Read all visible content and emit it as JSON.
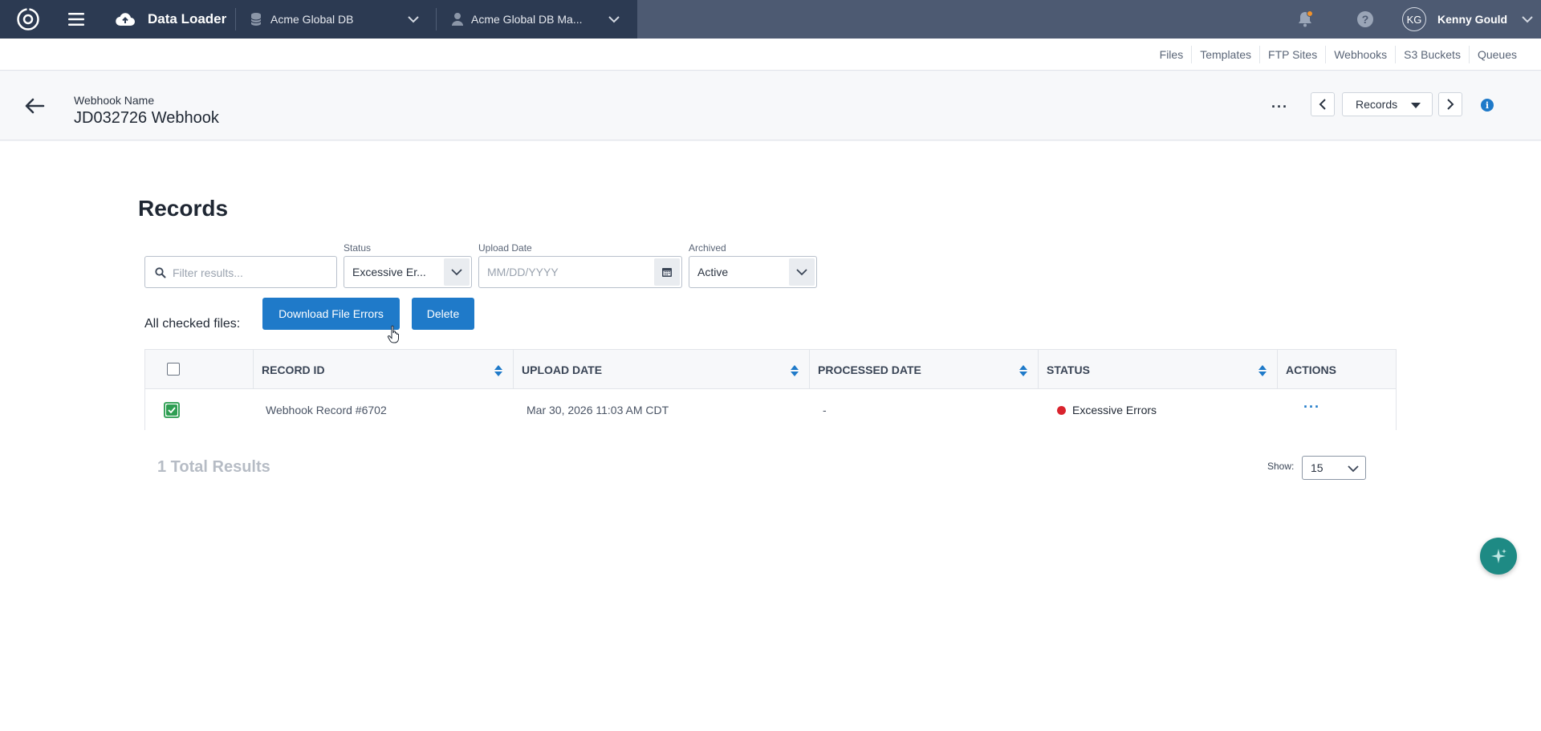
{
  "topbar": {
    "app_name": "Data Loader",
    "database": "Acme Global DB",
    "user_database": "Acme Global DB Ma...",
    "user_initials": "KG",
    "user_name": "Kenny Gould"
  },
  "subnav": {
    "items": [
      "Files",
      "Templates",
      "FTP Sites",
      "Webhooks",
      "S3 Buckets",
      "Queues"
    ]
  },
  "header": {
    "label": "Webhook Name",
    "name": "JD032726 Webhook",
    "more": "···",
    "records_dropdown": "Records",
    "info": "i"
  },
  "records": {
    "title": "Records",
    "search_placeholder": "Filter results...",
    "status_label": "Status",
    "status_value": "Excessive Er...",
    "upload_date_label": "Upload Date",
    "upload_date_placeholder": "MM/DD/YYYY",
    "archived_label": "Archived",
    "archived_value": "Active",
    "checked_label": "All checked files:",
    "download_button": "Download File Errors",
    "delete_button": "Delete"
  },
  "table": {
    "columns": [
      "RECORD ID",
      "UPLOAD DATE",
      "PROCESSED DATE",
      "STATUS",
      "ACTIONS"
    ],
    "rows": [
      {
        "record_id": "Webhook Record #6702",
        "upload_date": "Mar 30, 2026 11:03 AM CDT",
        "processed_date": "-",
        "status": "Excessive Errors",
        "actions": "···"
      }
    ]
  },
  "footer": {
    "total_results": "1 Total Results",
    "show_label": "Show:",
    "show_value": "15"
  },
  "colors": {
    "topbar": "#4d5a72",
    "topbar_left": "#2c3a52",
    "primary": "#1f7ac9",
    "status_error": "#d9232d",
    "checkbox_checked": "#2e9e52",
    "fab": "#1e8a84"
  }
}
